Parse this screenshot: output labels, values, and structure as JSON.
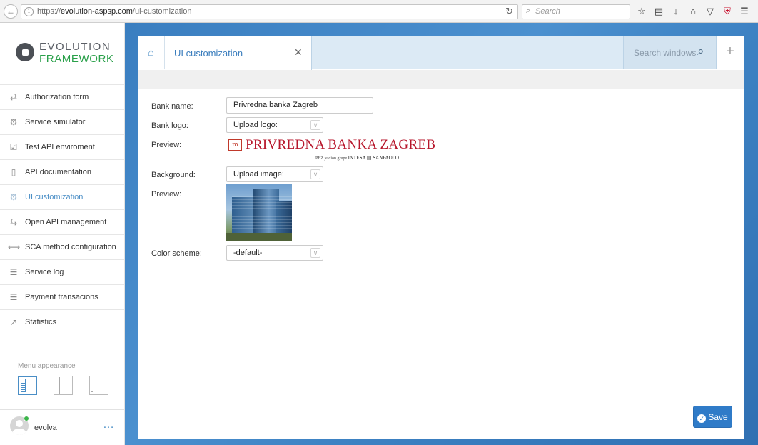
{
  "browser": {
    "url_prefix": "https://",
    "url_domain": "evolution-aspsp.com",
    "url_path": "/ui-customization",
    "search_placeholder": "Search",
    "back_glyph": "←",
    "reload_glyph": "↻",
    "toolbar_icons": [
      "star-icon",
      "reading-list-icon",
      "download-icon",
      "home-icon",
      "pocket-icon",
      "ublock-icon",
      "menu-icon"
    ]
  },
  "sidebar": {
    "logo_line1": "EVOLUTION",
    "logo_line2": "FRAMEWORK",
    "items": [
      {
        "label": "Authorization form",
        "icon": "⇄"
      },
      {
        "label": "Service simulator",
        "icon": "⚙"
      },
      {
        "label": "Test API enviroment",
        "icon": "☑"
      },
      {
        "label": "API documentation",
        "icon": "▯"
      },
      {
        "label": "UI customization",
        "icon": "⚙"
      },
      {
        "label": "Open API management",
        "icon": "⇆"
      },
      {
        "label": "SCA method configuration",
        "icon": "⟷"
      },
      {
        "label": "Service log",
        "icon": "☰"
      },
      {
        "label": "Payment transacions",
        "icon": "☰"
      },
      {
        "label": "Statistics",
        "icon": "↗"
      }
    ],
    "active_index": 4,
    "appearance_title": "Menu appearance",
    "user_name": "evolva",
    "user_more": "…"
  },
  "tabs": {
    "home_icon": "⌂",
    "active_title": "UI customization",
    "close_glyph": "✕",
    "search_label": "Search windows",
    "search_glyph": "⌕",
    "add_glyph": "+"
  },
  "form": {
    "bank_name_label": "Bank name:",
    "bank_name_value": "Privredna banka Zagreb",
    "bank_logo_label": "Bank logo:",
    "bank_logo_select": "Upload logo:",
    "preview_label_1": "Preview:",
    "logo_text": "PRIVREDNA BANKA ZAGREB",
    "logo_sub": "PBZ je dion grupe",
    "logo_sub_brand": "INTESA ▤ SANPAOLO",
    "background_label": "Background:",
    "background_select": "Upload image:",
    "preview_label_2": "Preview:",
    "color_scheme_label": "Color scheme:",
    "color_scheme_select": "-default-",
    "chevron_glyph": "∨"
  },
  "actions": {
    "save_label": "Save",
    "save_check": "✓"
  },
  "colors": {
    "accent": "#2f7bc8",
    "brand_green": "#2aa04a",
    "bank_red": "#b7162b"
  }
}
